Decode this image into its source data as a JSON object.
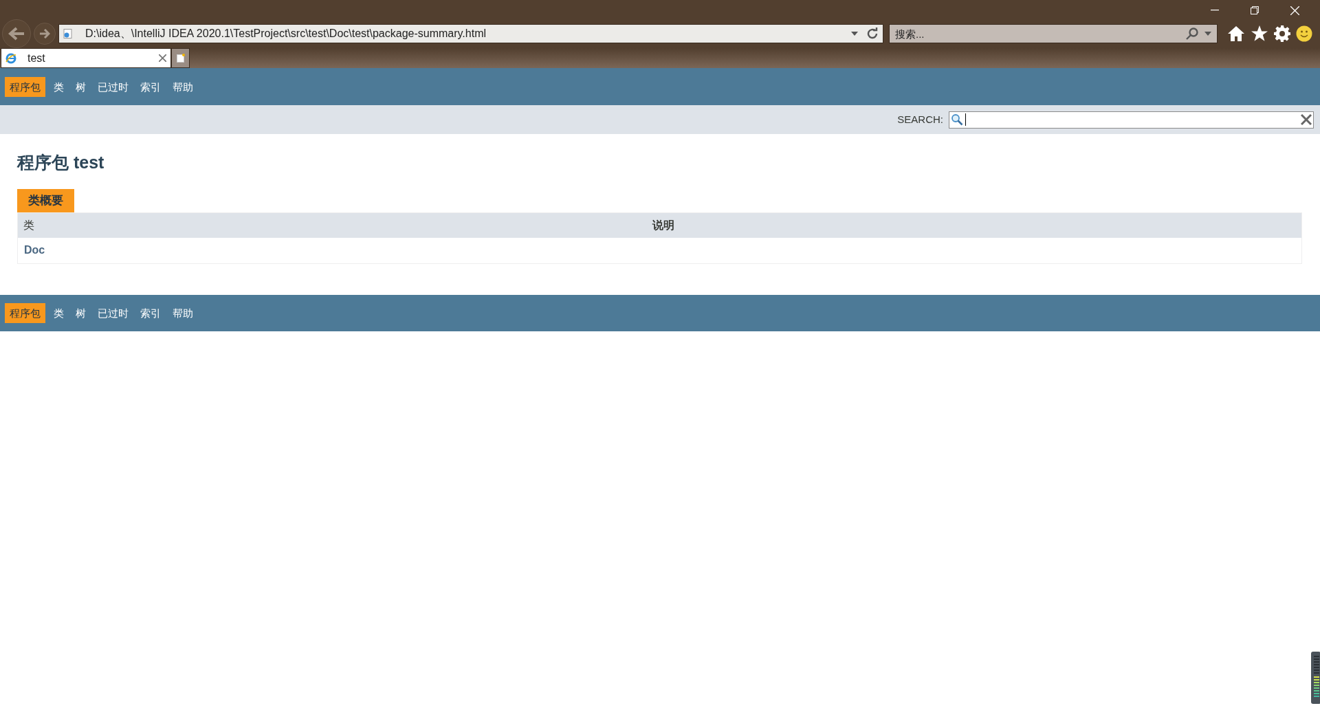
{
  "browser": {
    "address": "D:\\idea、\\IntelliJ IDEA 2020.1\\TestProject\\src\\test\\Doc\\test\\package-summary.html",
    "search_placeholder": "搜索...",
    "tabs": [
      {
        "label": "test",
        "selected": true
      }
    ]
  },
  "top_nav": [
    {
      "label": "程序包",
      "selected": true
    },
    {
      "label": "类",
      "selected": false
    },
    {
      "label": "树",
      "selected": false
    },
    {
      "label": "已过时",
      "selected": false
    },
    {
      "label": "索引",
      "selected": false
    },
    {
      "label": "帮助",
      "selected": false
    }
  ],
  "search": {
    "label": "SEARCH:"
  },
  "title": "程序包 test",
  "summary": {
    "caption": "类概要",
    "columns": [
      "类",
      "说明"
    ],
    "rows": [
      {
        "class": "Doc",
        "description": ""
      }
    ]
  },
  "bottom_nav": [
    {
      "label": "程序包",
      "selected": true
    },
    {
      "label": "类",
      "selected": false
    },
    {
      "label": "树",
      "selected": false
    },
    {
      "label": "已过时",
      "selected": false
    },
    {
      "label": "索引",
      "selected": false
    },
    {
      "label": "帮助",
      "selected": false
    }
  ]
}
